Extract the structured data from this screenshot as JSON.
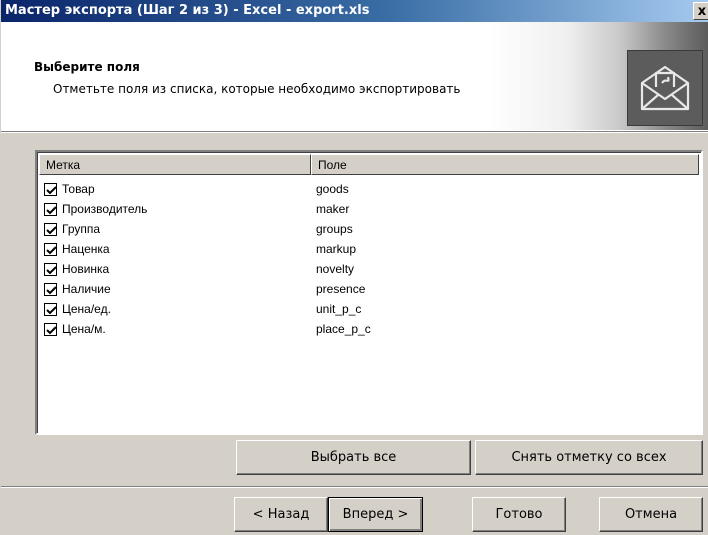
{
  "window": {
    "title": "Мастер экспорта (Шаг 2 из 3) - Excel - export.xls",
    "close_glyph": "x"
  },
  "header": {
    "title": "Выберите поля",
    "subtitle": "Отметьте поля из списка, которые необходимо экспортировать",
    "icon": "envelope-icon"
  },
  "list": {
    "columns": [
      "Метка",
      "Поле"
    ],
    "rows": [
      {
        "label": "Товар",
        "field": "goods",
        "checked": true
      },
      {
        "label": "Производитель",
        "field": "maker",
        "checked": true
      },
      {
        "label": "Группа",
        "field": "groups",
        "checked": true
      },
      {
        "label": "Наценка",
        "field": "markup",
        "checked": true
      },
      {
        "label": "Новинка",
        "field": "novelty",
        "checked": true
      },
      {
        "label": "Наличие",
        "field": "presence",
        "checked": true
      },
      {
        "label": "Цена/ед.",
        "field": "unit_p_c",
        "checked": true
      },
      {
        "label": "Цена/м.",
        "field": "place_p_c",
        "checked": true
      }
    ]
  },
  "buttons": {
    "select_all": "Выбрать все",
    "deselect_all": "Снять отметку со всех",
    "back": "< Назад",
    "next": "Вперед >",
    "finish": "Готово",
    "cancel": "Отмена"
  },
  "colors": {
    "title_bar": "#0a246a",
    "face": "#d4d0c8"
  }
}
